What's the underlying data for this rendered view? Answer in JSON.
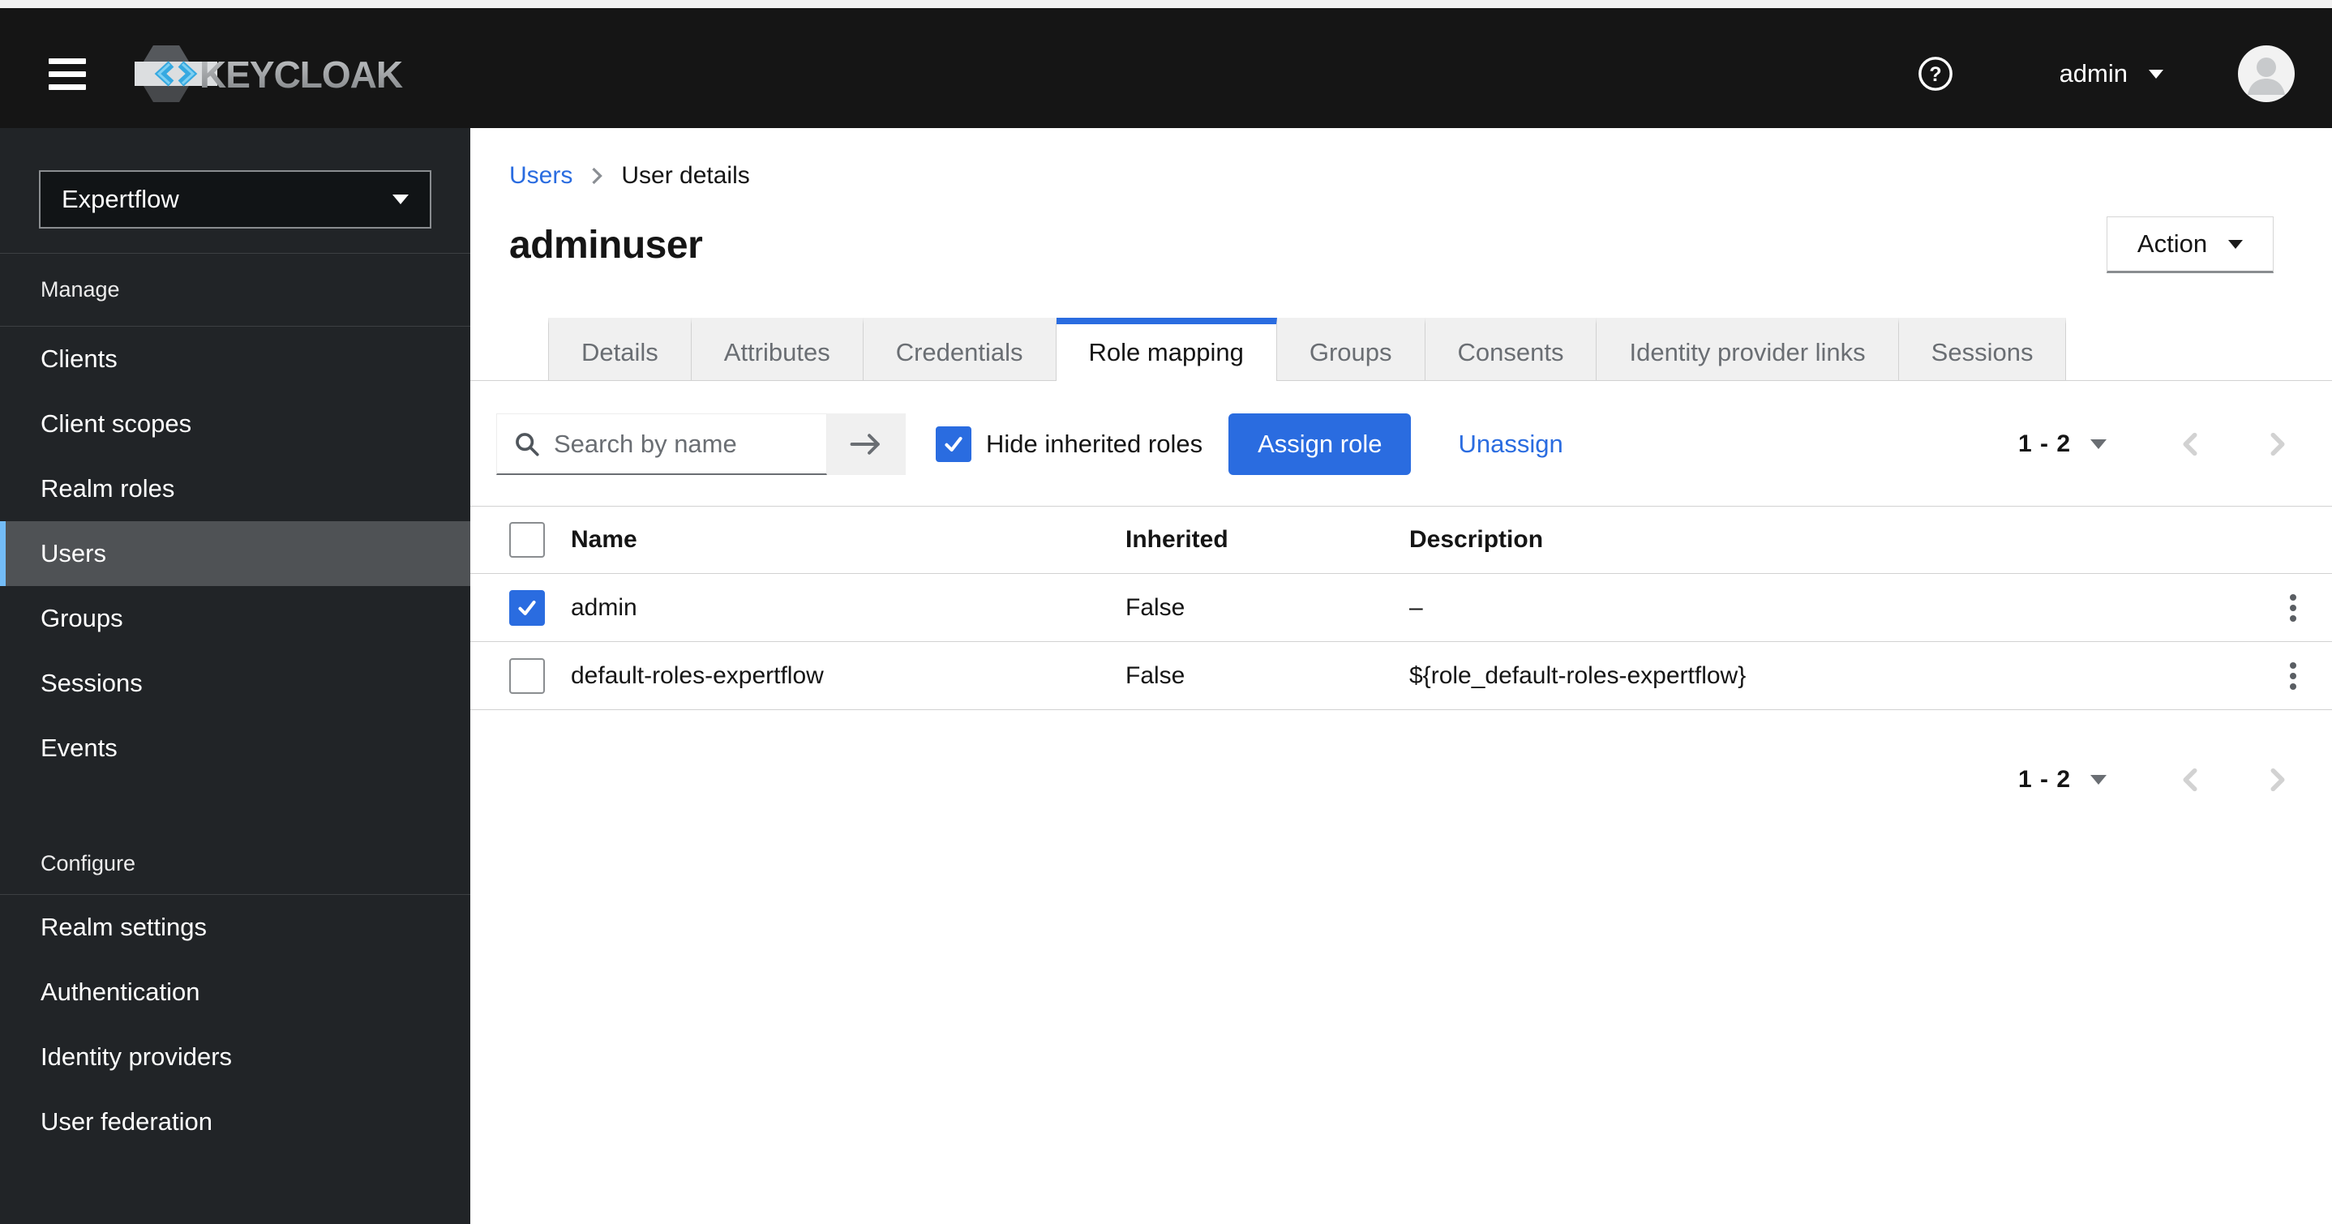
{
  "colors": {
    "primary_blue": "#2a6ce0",
    "nav_accent": "#73bcf7",
    "header_bg": "#151515",
    "sidebar_bg": "#212427",
    "sidebar_selected_bg": "#4f5255",
    "sidebar_divider": "#3c3f42",
    "border_light": "#d2d2d2",
    "text_dark": "#151515",
    "text_muted": "#6a6e73",
    "tab_inactive_bg": "#f0f0f0",
    "disabled_chevron": "#d2d2d2"
  },
  "icons": {
    "hamburger": "bars",
    "help": "question-circle",
    "help_glyph": "?",
    "user_caret": "caret-down",
    "avatar": "user-silhouette",
    "realm_caret": "caret-down",
    "action_caret": "caret-down",
    "search": "magnifier",
    "search_submit": "arrow-right",
    "breadcrumb_separator": "angle-right",
    "pagination_menu": "caret-down",
    "pagination_prev": "angle-left",
    "pagination_next": "angle-right",
    "row_actions": "kebab-vertical",
    "checkbox_check": "check"
  },
  "masthead": {
    "brand": "KEYCLOAK",
    "user_menu": {
      "label": "admin"
    }
  },
  "sidebar": {
    "realm_selector": {
      "value": "Expertflow"
    },
    "sections": [
      {
        "label": "Manage",
        "items": [
          {
            "label": "Clients",
            "selected": false
          },
          {
            "label": "Client scopes",
            "selected": false
          },
          {
            "label": "Realm roles",
            "selected": false
          },
          {
            "label": "Users",
            "selected": true
          },
          {
            "label": "Groups",
            "selected": false
          },
          {
            "label": "Sessions",
            "selected": false
          },
          {
            "label": "Events",
            "selected": false
          }
        ]
      },
      {
        "label": "Configure",
        "items": [
          {
            "label": "Realm settings",
            "selected": false
          },
          {
            "label": "Authentication",
            "selected": false
          },
          {
            "label": "Identity providers",
            "selected": false
          },
          {
            "label": "User federation",
            "selected": false
          }
        ]
      }
    ]
  },
  "breadcrumb": {
    "link": "Users",
    "current": "User details"
  },
  "page": {
    "title": "adminuser",
    "action_button": "Action"
  },
  "tabs": [
    {
      "label": "Details",
      "active": false
    },
    {
      "label": "Attributes",
      "active": false
    },
    {
      "label": "Credentials",
      "active": false
    },
    {
      "label": "Role mapping",
      "active": true
    },
    {
      "label": "Groups",
      "active": false
    },
    {
      "label": "Consents",
      "active": false
    },
    {
      "label": "Identity provider links",
      "active": false
    },
    {
      "label": "Sessions",
      "active": false
    }
  ],
  "toolbar": {
    "search_placeholder": "Search by name",
    "hide_inherited": {
      "label": "Hide inherited roles",
      "checked": true
    },
    "assign_button": "Assign role",
    "unassign_link": "Unassign"
  },
  "pagination": {
    "range": "1 - 2"
  },
  "table": {
    "columns": [
      "Name",
      "Inherited",
      "Description"
    ],
    "rows": [
      {
        "checked": true,
        "name": "admin",
        "inherited": "False",
        "description": "–"
      },
      {
        "checked": false,
        "name": "default-roles-expertflow",
        "inherited": "False",
        "description": "${role_default-roles-expertflow}"
      }
    ]
  }
}
